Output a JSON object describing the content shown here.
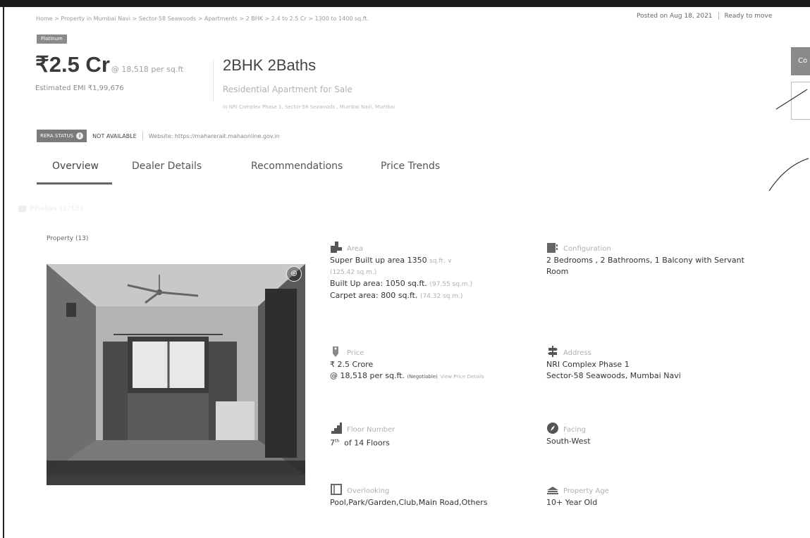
{
  "breadcrumb": "Home > Property in Mumbai Navi > Sector-58 Seawoods > Apartments > 2 BHK > 2.4 to 2.5 Cr > 1300 to 1400 sq.ft.",
  "posted": "Posted on Aug 18, 2021",
  "ready": "Ready to move",
  "badge": "Platinum",
  "price": {
    "main": "₹2.5 Cr",
    "per_sqft": "@ 18,518 per sq.ft",
    "emi": "Estimated EMI ₹1,99,676"
  },
  "listing": {
    "title": "2BHK 2Baths",
    "subtitle": "Residential Apartment for Sale",
    "locality": "in NRI Complex Phase 1, Sector-58 Seawoods , Mumbai Navi, Mumbai"
  },
  "rera": {
    "tag": "RERA STATUS",
    "status": "NOT AVAILABLE",
    "website": "Website: https://maharerait.mahaonline.gov.in"
  },
  "tabs": [
    "Overview",
    "Dealer Details",
    "Recommendations",
    "Price Trends"
  ],
  "side_button": "Co",
  "property_count": "Property (13)",
  "photos_label": "Photos (1/13)",
  "attributes": {
    "area": {
      "label": "Area",
      "super_built": "Super Built up area 1350",
      "unit": "sq.ft. ∨",
      "super_sqm": "(125.42 sq.m.)",
      "built_up": "Built Up area: 1050 sq.ft.",
      "built_up_sqm": "(97.55 sq.m.)",
      "carpet": "Carpet area: 800 sq.ft.",
      "carpet_sqm": "(74.32 sq.m.)"
    },
    "configuration": {
      "label": "Configuration",
      "value": "2 Bedrooms , 2 Bathrooms, 1 Balcony with Servant Room"
    },
    "price": {
      "label": "Price",
      "value": "₹ 2.5 Crore",
      "per": "@ 18,518 per sq.ft.",
      "negotiable": "(Negotiable)",
      "link": "View Price Details"
    },
    "address": {
      "label": "Address",
      "line1": "NRI Complex Phase 1",
      "line2": "Sector-58 Seawoods, Mumbai Navi"
    },
    "floor": {
      "label": "Floor Number",
      "floor_num": "7",
      "floor_suffix": "th",
      "of": "of 14 Floors"
    },
    "facing": {
      "label": "Facing",
      "value": "South-West"
    },
    "overlooking": {
      "label": "Overlooking",
      "value": "Pool,Park/Garden,Club,Main Road,Others"
    },
    "age": {
      "label": "Property Age",
      "value": "10+ Year Old"
    }
  }
}
